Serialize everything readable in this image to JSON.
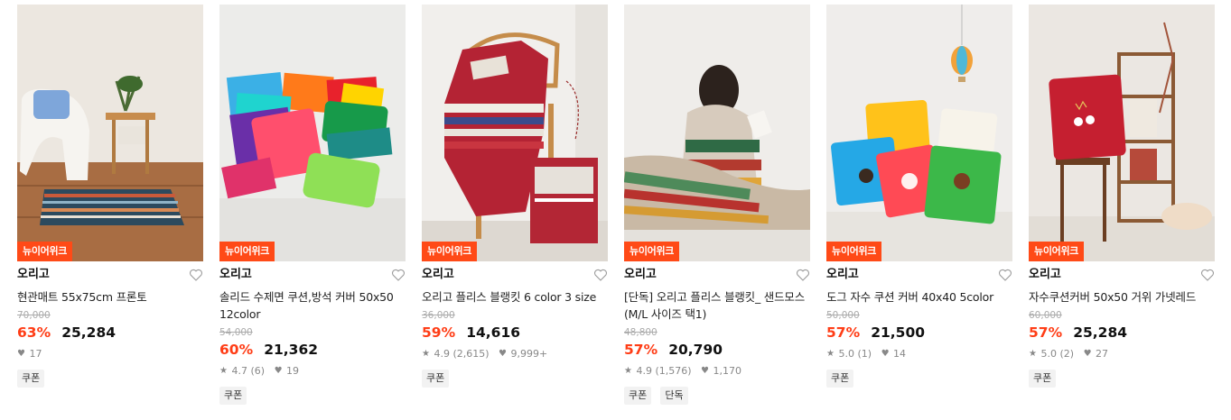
{
  "products": [
    {
      "badge": "뉴이어위크",
      "brand": "오리고",
      "name": "현관매트 55x75cm 프론토",
      "original_price": "70,000",
      "discount": "63%",
      "price": "25,284",
      "rating": "",
      "reviews": "",
      "likes": "17",
      "tags": [
        "쿠폰"
      ]
    },
    {
      "badge": "뉴이어위크",
      "brand": "오리고",
      "name": "솔리드 수제면 쿠션,방석 커버 50x50 12color",
      "original_price": "54,000",
      "discount": "60%",
      "price": "21,362",
      "rating": "4.7",
      "reviews": "(6)",
      "likes": "19",
      "tags": [
        "쿠폰"
      ]
    },
    {
      "badge": "뉴이어위크",
      "brand": "오리고",
      "name": "오리고 플리스 블랭킷 6 color 3 size",
      "original_price": "36,000",
      "discount": "59%",
      "price": "14,616",
      "rating": "4.9",
      "reviews": "(2,615)",
      "likes": "9,999+",
      "tags": [
        "쿠폰"
      ]
    },
    {
      "badge": "뉴이어위크",
      "brand": "오리고",
      "name": "[단독] 오리고 플리스 블랭킷_ 샌드모스 (M/L 사이즈 택1)",
      "original_price": "48,800",
      "discount": "57%",
      "price": "20,790",
      "rating": "4.9",
      "reviews": "(1,576)",
      "likes": "1,170",
      "tags": [
        "쿠폰",
        "단독"
      ]
    },
    {
      "badge": "뉴이어위크",
      "brand": "오리고",
      "name": "도그 자수 쿠션 커버 40x40 5color",
      "original_price": "50,000",
      "discount": "57%",
      "price": "21,500",
      "rating": "5.0",
      "reviews": "(1)",
      "likes": "14",
      "tags": [
        "쿠폰"
      ]
    },
    {
      "badge": "뉴이어위크",
      "brand": "오리고",
      "name": "자수쿠션커버 50x50 거위 가넷레드",
      "original_price": "60,000",
      "discount": "57%",
      "price": "25,284",
      "rating": "5.0",
      "reviews": "(2)",
      "likes": "27",
      "tags": [
        "쿠폰"
      ]
    }
  ],
  "icons": {
    "heart": "heart-outline-icon",
    "star": "star-icon",
    "like": "heart-filled-icon"
  },
  "colors": {
    "badge": "#ff4a17",
    "discount": "#ff3d16"
  }
}
